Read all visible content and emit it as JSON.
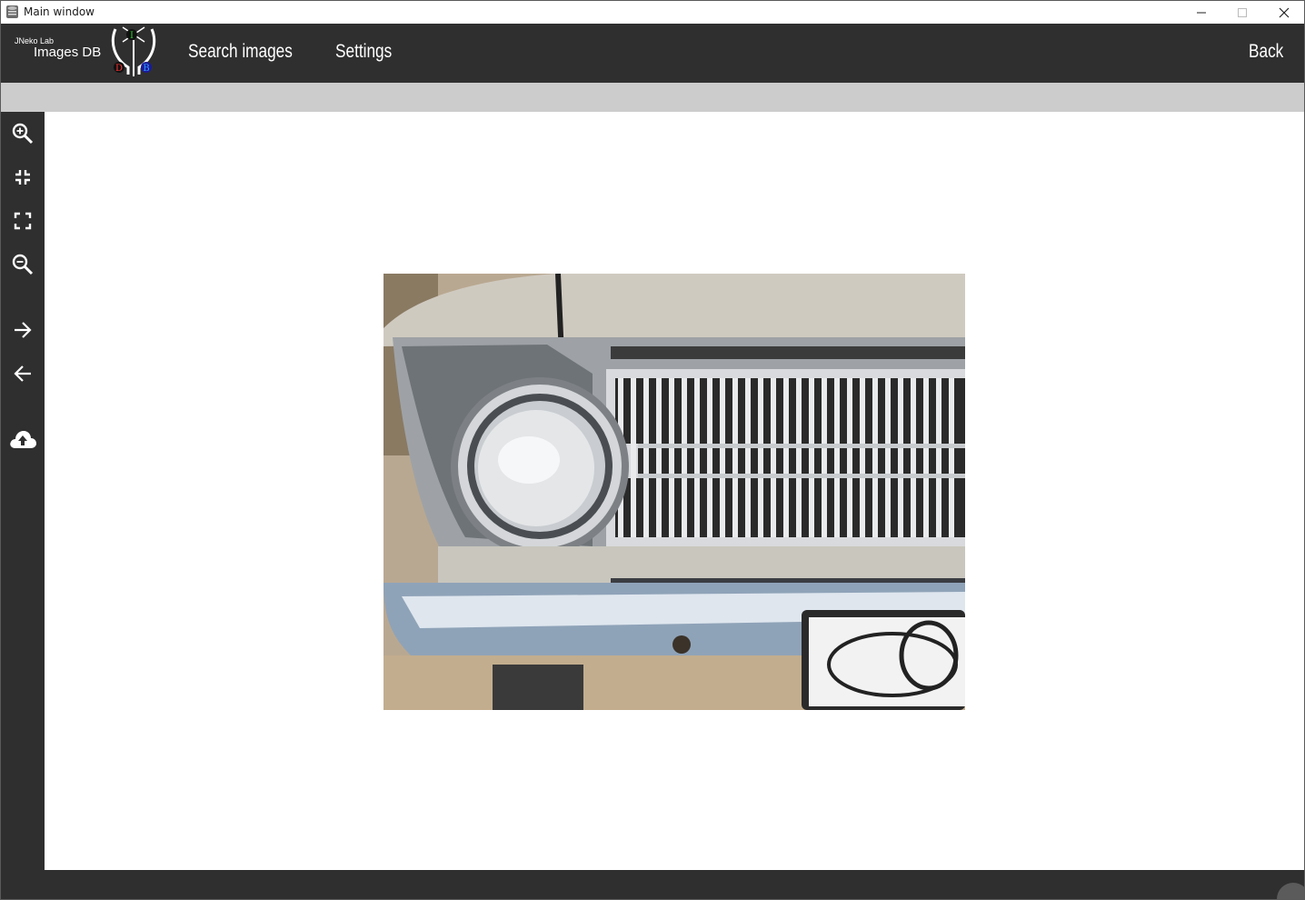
{
  "window": {
    "title": "Main window",
    "controls": {
      "minimize": "minimize",
      "maximize": "maximize",
      "close": "close"
    }
  },
  "header": {
    "logo_small": "JNeko Lab",
    "logo_big": "Images DB",
    "logo_letters": [
      "I",
      "D",
      "B"
    ],
    "nav": {
      "search": "Search images",
      "settings": "Settings",
      "back": "Back"
    }
  },
  "sidebar": {
    "tools": [
      {
        "icon": "zoom-in-icon"
      },
      {
        "icon": "fit-screen-icon"
      },
      {
        "icon": "fullscreen-icon"
      },
      {
        "icon": "zoom-out-icon"
      },
      {
        "icon": "arrow-right-icon"
      },
      {
        "icon": "arrow-left-icon"
      },
      {
        "icon": "cloud-upload-icon"
      }
    ]
  },
  "viewer": {
    "image_subject": "classic car headlight and grille"
  },
  "colors": {
    "bar": "#2f2f2f",
    "strip": "#cccccc",
    "text": "#ffffff"
  }
}
